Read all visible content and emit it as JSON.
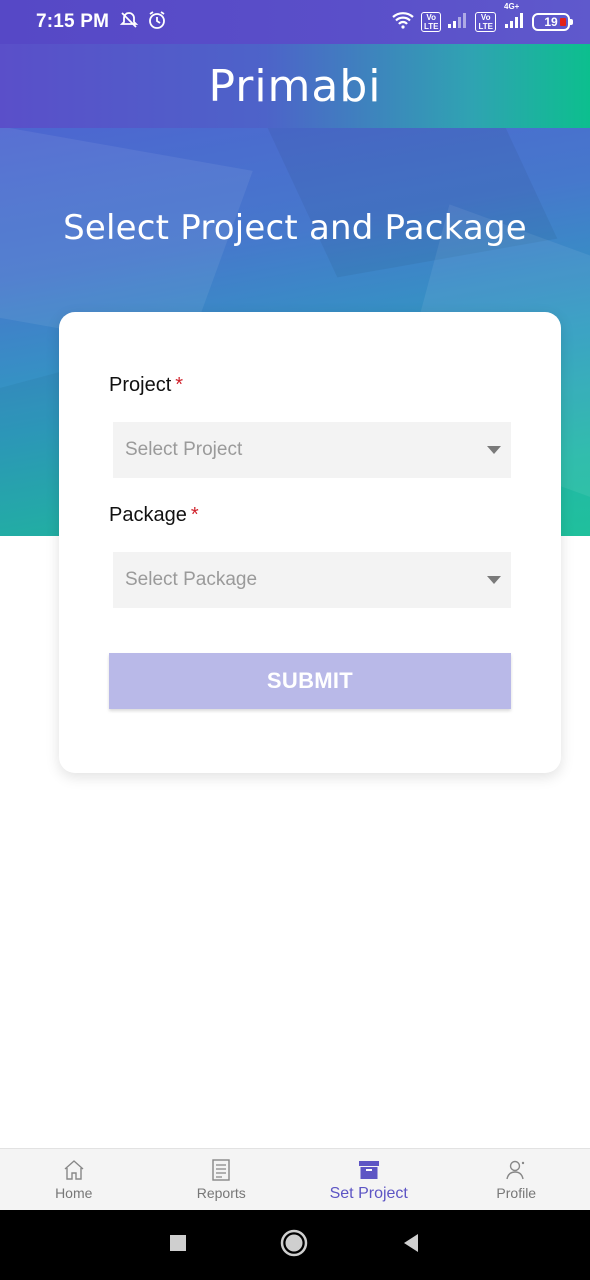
{
  "status_bar": {
    "time": "7:15 PM",
    "battery": "19",
    "network_label": "4G+",
    "volte_label": "Vo\nLTE"
  },
  "header": {
    "logo_text": "Primabi"
  },
  "hero": {
    "title": "Select Project and Package"
  },
  "form": {
    "project_label": "Project",
    "project_required": "*",
    "project_placeholder": "Select Project",
    "package_label": "Package",
    "package_required": "*",
    "package_placeholder": "Select Package",
    "submit_label": "SUBMIT"
  },
  "bottom_nav": {
    "items": [
      {
        "label": "Home",
        "icon": "home-icon"
      },
      {
        "label": "Reports",
        "icon": "reports-icon"
      },
      {
        "label": "Set Project",
        "icon": "archive-box-icon",
        "active": true
      },
      {
        "label": "Profile",
        "icon": "profile-icon"
      }
    ]
  },
  "colors": {
    "accent": "#5d55c4",
    "submit_disabled": "#b9b9e8",
    "required": "#d0212b"
  }
}
